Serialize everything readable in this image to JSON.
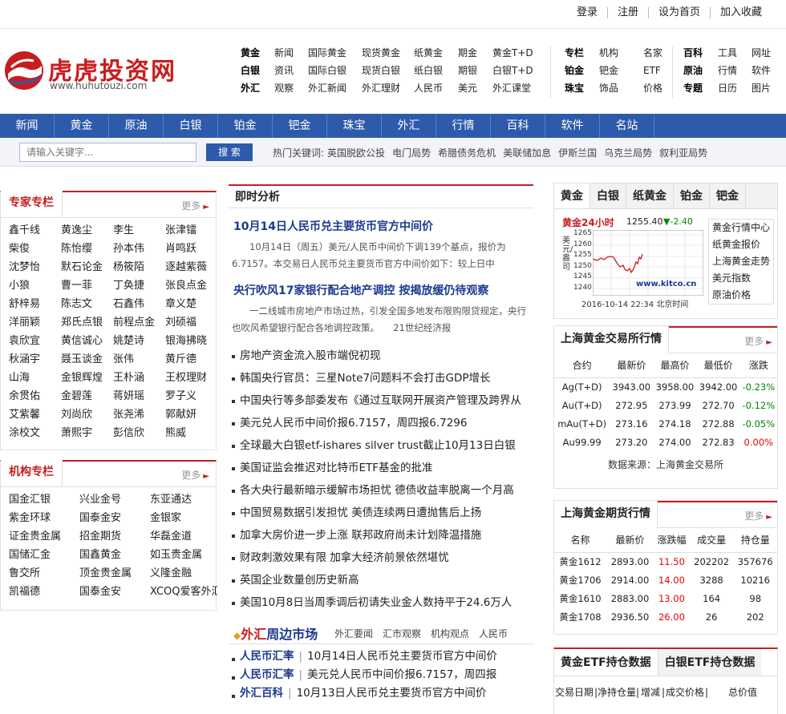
{
  "toplinks": [
    "登录",
    "注册",
    "设为首页",
    "加入收藏"
  ],
  "logo": {
    "name": "虎虎投资网",
    "url": "www.huhutouzi.com"
  },
  "header_nav": [
    {
      "rows": [
        [
          "黄金",
          "新闻",
          "国际黄金",
          "现货黄金",
          "纸黄金",
          "期金",
          "黄金T+D"
        ],
        [
          "白银",
          "资讯",
          "国际白银",
          "现货白银",
          "纸白银",
          "期银",
          "白银T+D"
        ],
        [
          "外汇",
          "观察",
          "外汇新闻",
          "外汇理财",
          "人民币",
          "美元",
          "外汇课堂"
        ]
      ]
    },
    {
      "rows": [
        [
          "专栏",
          "机构",
          "名家"
        ],
        [
          "铂金",
          "钯金",
          "ETF"
        ],
        [
          "珠宝",
          "饰品",
          "价格"
        ]
      ]
    },
    {
      "rows": [
        [
          "百科",
          "工具",
          "网址"
        ],
        [
          "原油",
          "行情",
          "软件"
        ],
        [
          "专题",
          "日历",
          "图片"
        ]
      ]
    }
  ],
  "main_nav": [
    "新闻",
    "黄金",
    "原油",
    "白银",
    "铂金",
    "钯金",
    "珠宝",
    "外汇",
    "行情",
    "百科",
    "软件",
    "名站"
  ],
  "search": {
    "placeholder": "请输入关键字...",
    "button": "搜 索"
  },
  "hot_keywords": {
    "label": "热门关键词:",
    "items": [
      "英国脱欧公投",
      "电门局势",
      "希腊债务危机",
      "美联储加息",
      "伊斯兰国",
      "乌克兰局势",
      "叙利亚局势"
    ]
  },
  "experts": {
    "title": "专家专栏",
    "more": "更多",
    "items": [
      "鑫千线",
      "黄逸尘",
      "李生",
      "张津镭",
      "柴俊",
      "陈怡缨",
      "孙本伟",
      "肖鸣跃",
      "沈梦怡",
      "默石论金",
      "杨筱陌",
      "逐越紫薇",
      "小狼",
      "曹一菲",
      "丁奂捷",
      "张良点金",
      "舒梓易",
      "陈志文",
      "石鑫伟",
      "章义楚",
      "洋丽颖",
      "郑氏点银",
      "前程点金",
      "刘硕福",
      "袁欣宜",
      "黄信诚心",
      "姚楚诗",
      "银海拂晓",
      "秋涵宇",
      "聂玉谈金",
      "张伟",
      "黄斤德",
      "山海",
      "金银辉煌",
      "王朴涵",
      "王权理财",
      "余贯佑",
      "金碧莲",
      "蒋妍瑶",
      "罗子义",
      "艾紫馨",
      "刘尚欣",
      "张尧浠",
      "郭献妍",
      "涂校文",
      "萧熙宇",
      "彭信欣",
      "熊威"
    ]
  },
  "institutions": {
    "title": "机构专栏",
    "more": "更多",
    "items": [
      "国金汇银",
      "兴业金号",
      "东亚通达",
      "紫金环球",
      "国泰金安",
      "金银家",
      "证金贵金属",
      "招金期货",
      "华磊金道",
      "国储汇金",
      "国鑫黄金",
      "如玉贵金属",
      "鲁交所",
      "顶金贵金属",
      "义隆金融",
      "凯福德",
      "国泰金安",
      "XCOQ爱客外汇"
    ]
  },
  "analysis": {
    "title": "即时分析",
    "articles": [
      {
        "title": "10月14日人民币兑主要货币官方中间价",
        "summary": "10月14日（周五）美元/人民币中间价下调139个基点，报价为6.7157。本交易日人民币兑主要货币官方中间价如下：较上日中"
      },
      {
        "title": "央行吹风17家银行配合地产调控 按揭放缓仍待观察",
        "summary": "一二线城市房地产市场过热，引发全国多地发布限购限贷规定，央行也吹风希望银行配合各地调控政策。　　21世纪经济报"
      }
    ],
    "news": [
      "房地产资金流入股市端倪初现",
      "韩国央行官员：三星Note7问题料不会打击GDP增长",
      "中国央行等多部委发布《通过互联网开展资产管理及跨界从",
      "美元兑人民币中间价报6.7157，周四报6.7296",
      "全球最大白银etf-ishares silver trust截止10月13日白银",
      "美国证监会推迟对比特币ETF基金的批准",
      "各大央行最新暗示缓解市场担忧 德债收益率脱离一个月高",
      "中国贸易数据引发担忧 美债连续两日遭抛售后上扬",
      "加拿大房价进一步上涨 联邦政府尚未计划降温措施",
      "财政刺激效果有限 加拿大经济前景依然堪忧",
      "英国企业数量创历史新高",
      "美国10月8日当周季调后初请失业金人数持平于24.6万人"
    ]
  },
  "fx": {
    "title_a": "外汇",
    "title_b": "周边市场",
    "links": [
      "外汇要闻",
      "汇市观察",
      "机构观点",
      "人民币"
    ],
    "items": [
      {
        "tag": "人民币汇率",
        "text": "10月14日人民币兑主要货币官方中间价"
      },
      {
        "tag": "人民币汇率",
        "text": "美元兑人民币中间价报6.7157，周四报"
      },
      {
        "tag": "外汇百科",
        "text": "10月13日人民币兑主要货币官方中间价"
      }
    ]
  },
  "gold_tabs": [
    "黄金",
    "白银",
    "纸黄金",
    "铂金",
    "钯金"
  ],
  "gold_chart": {
    "title": "黄金24小时",
    "price": "1255.40",
    "change": "-2.40",
    "ylabel": "美元/盎司",
    "site": "www.kitco.cn",
    "date": "2016-10-14 22:34",
    "tz": "北京时间",
    "yticks": [
      "1265",
      "1260",
      "1255",
      "1250",
      "1245",
      "1240"
    ],
    "links": [
      "黄金行情中心",
      "纸黄金报价",
      "上海黄金走势",
      "美元指数",
      "原油价格"
    ]
  },
  "sge": {
    "title": "上海黄金交易所行情",
    "more": "更多",
    "headers": [
      "合约",
      "最新价",
      "最高价",
      "最低价",
      "涨跌"
    ],
    "rows": [
      [
        "Ag(T+D)",
        "3943.00",
        "3958.00",
        "3942.00",
        "-0.23%"
      ],
      [
        "Au(T+D)",
        "272.95",
        "273.99",
        "272.70",
        "-0.12%"
      ],
      [
        "mAu(T+D)",
        "273.16",
        "274.18",
        "272.88",
        "-0.05%"
      ],
      [
        "Au99.99",
        "273.20",
        "274.00",
        "272.83",
        "0.00%"
      ]
    ],
    "source": "数据来源：上海黄金交易所"
  },
  "shfe": {
    "title": "上海黄金期货行情",
    "more": "更多",
    "headers": [
      "名称",
      "最新价",
      "涨跌幅",
      "成交量",
      "持仓量"
    ],
    "rows": [
      [
        "黄金1612",
        "2893.00",
        "11.50",
        "202202",
        "357676"
      ],
      [
        "黄金1706",
        "2914.00",
        "14.00",
        "3288",
        "10216"
      ],
      [
        "黄金1610",
        "2883.00",
        "13.00",
        "164",
        "98"
      ],
      [
        "黄金1708",
        "2936.50",
        "26.00",
        "26",
        "202"
      ]
    ]
  },
  "etf": {
    "tabs": [
      "黄金ETF持仓数据",
      "白银ETF持仓数据"
    ],
    "headers": [
      "交易日期",
      "净持仓量",
      "增减",
      "成交价格",
      "总价值"
    ]
  }
}
